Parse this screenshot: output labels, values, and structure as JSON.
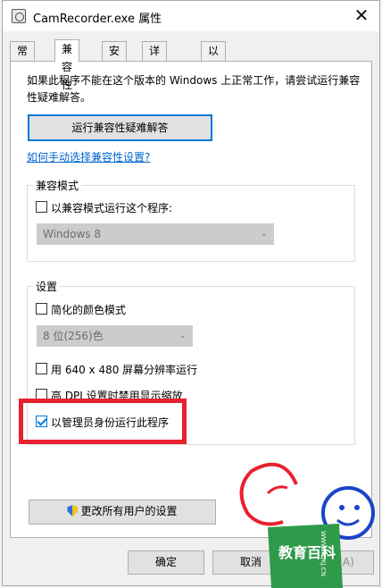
{
  "window": {
    "title": "CamRecorder.exe 属性"
  },
  "tabs": [
    {
      "label": "常规"
    },
    {
      "label": "兼容性"
    },
    {
      "label": "安全"
    },
    {
      "label": "详细信息"
    },
    {
      "label": "以前的版本"
    }
  ],
  "compat": {
    "intro": "如果此程序不能在这个版本的 Windows 上正常工作，请尝试运行兼容性疑难解答。",
    "run_troubleshooter": "运行兼容性疑难解答",
    "manual_link": "如何手动选择兼容性设置?",
    "mode_group": {
      "title": "兼容模式",
      "checkbox_label": "以兼容模式运行这个程序:",
      "checked": false,
      "select_value": "Windows 8"
    },
    "settings_group": {
      "title": "设置",
      "reduced_color": {
        "label": "简化的颜色模式",
        "checked": false
      },
      "color_select": "8 位(256)色",
      "res_640": {
        "label": "用 640 x 480 屏幕分辨率运行",
        "checked": false
      },
      "high_dpi": {
        "label": "高 DPI 设置时禁用显示缩放",
        "checked": false
      },
      "run_as_admin": {
        "label": "以管理员身份运行此程序",
        "checked": true
      }
    },
    "change_all_users": "更改所有用户的设置"
  },
  "footer": {
    "ok": "确定",
    "cancel": "取消",
    "apply": "应用(A)"
  },
  "colors": {
    "highlight": "#e8212f",
    "link": "#0066cc",
    "accent": "#0078d7"
  },
  "watermark": {
    "text": "教育百科",
    "url_text": "WWW.TQKJ.CN"
  }
}
